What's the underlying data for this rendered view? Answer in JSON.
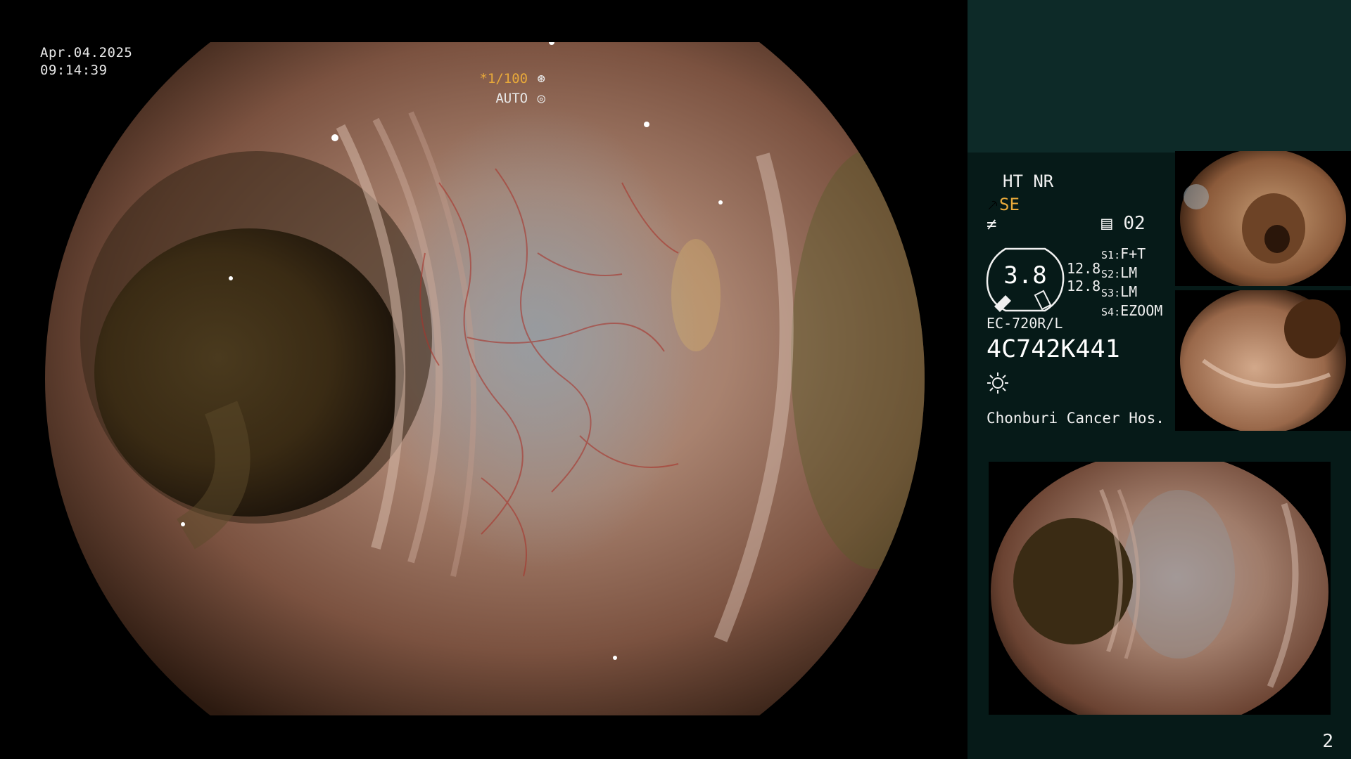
{
  "overlay": {
    "date": "Apr.04.2025",
    "time": "09:14:39",
    "shutter_speed": "*1/100",
    "shutter_icon": "aperture-icon",
    "iris_mode": "AUTO",
    "iris_icon": "iris-icon"
  },
  "panel": {
    "mode_flags": "HT NR",
    "enhancement_mode": "SE",
    "enhancement_icon": "scope-tip-icon",
    "structure_icon": "structure-enhance-icon",
    "image_count": "02",
    "image_count_icon": "memory-card-icon",
    "gauge_value": "3.8",
    "gauge_sub_1": "12.8",
    "gauge_sub_2": "12.8",
    "settings": [
      {
        "key": "S1",
        "value": "F+T"
      },
      {
        "key": "S2",
        "value": "LM"
      },
      {
        "key": "S3",
        "value": "LM"
      },
      {
        "key": "S4",
        "value": "EZOOM"
      }
    ],
    "scope_model": "EC-720R/L",
    "scope_serial": "4C742K441",
    "light_icon": "light-source-icon",
    "hospital": "Chonburi Cancer Hos.",
    "page_number": "2"
  },
  "colors": {
    "accent": "#e8a93a",
    "panel_bg": "#061a18",
    "panel_top_bg": "#0d2a28"
  }
}
